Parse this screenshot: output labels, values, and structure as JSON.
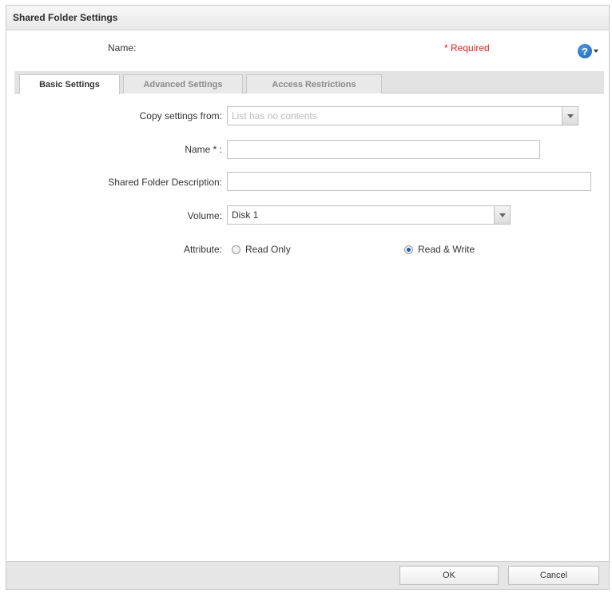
{
  "dialog": {
    "title": "Shared Folder Settings",
    "name_label": "Name:",
    "required_text": "* Required",
    "help_icon": "help-icon"
  },
  "tabs": [
    {
      "label": "Basic Settings",
      "active": true
    },
    {
      "label": "Advanced Settings",
      "active": false
    },
    {
      "label": "Access Restrictions",
      "active": false
    }
  ],
  "form": {
    "copy_settings_label": "Copy settings from:",
    "copy_settings_placeholder": "List has no contents",
    "name_label": "Name * :",
    "name_value": "",
    "description_label": "Shared Folder Description:",
    "description_value": "",
    "volume_label": "Volume:",
    "volume_value": "Disk 1",
    "attribute_label": "Attribute:",
    "attribute_options": [
      {
        "label": "Read Only",
        "checked": false
      },
      {
        "label": "Read & Write",
        "checked": true
      }
    ]
  },
  "footer": {
    "ok_label": "OK",
    "cancel_label": "Cancel"
  },
  "colors": {
    "required": "#e02020",
    "help_icon": "#1a5fb4"
  }
}
